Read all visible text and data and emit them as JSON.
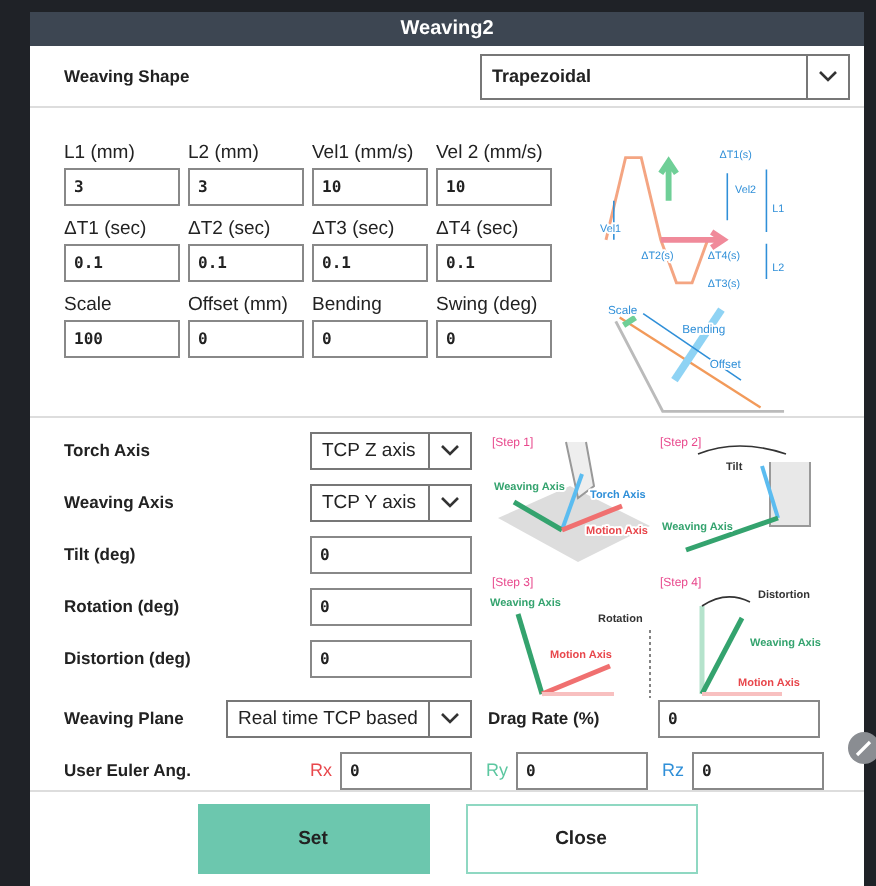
{
  "window": {
    "title": "Weaving2"
  },
  "weaving_shape": {
    "label": "Weaving Shape",
    "value": "Trapezoidal"
  },
  "parameters": [
    {
      "label": "L1 (mm)",
      "value": "3"
    },
    {
      "label": "L2 (mm)",
      "value": "3"
    },
    {
      "label": "Vel1 (mm/s)",
      "value": "10"
    },
    {
      "label": "Vel 2 (mm/s)",
      "value": "10"
    },
    {
      "label": "ΔT1 (sec)",
      "value": "0.1"
    },
    {
      "label": "ΔT2 (sec)",
      "value": "0.1"
    },
    {
      "label": "ΔT3 (sec)",
      "value": "0.1"
    },
    {
      "label": "ΔT4 (sec)",
      "value": "0.1"
    },
    {
      "label": "Scale",
      "value": "100"
    },
    {
      "label": "Offset (mm)",
      "value": "0"
    },
    {
      "label": "Bending",
      "value": "0"
    },
    {
      "label": "Swing (deg)",
      "value": "0"
    }
  ],
  "shape_diagram": {
    "labels": [
      "ΔT1(s)",
      "Vel2",
      "L1",
      "Vel1",
      "ΔT2(s)",
      "ΔT4(s)",
      "L2",
      "ΔT3(s)"
    ]
  },
  "offset_diagram": {
    "labels": [
      "Scale",
      "Bending",
      "Offset"
    ]
  },
  "axis_fields": [
    {
      "label": "Torch Axis",
      "kind": "select",
      "value": "TCP Z axis"
    },
    {
      "label": "Weaving Axis",
      "kind": "select",
      "value": "TCP Y axis"
    },
    {
      "label": "Tilt (deg)",
      "kind": "input",
      "value": "0"
    },
    {
      "label": "Rotation (deg)",
      "kind": "input",
      "value": "0"
    },
    {
      "label": "Distortion (deg)",
      "kind": "input",
      "value": "0"
    }
  ],
  "steps": [
    {
      "title": "[Step 1]",
      "labels": [
        "Torch Axis",
        "Weaving Axis",
        "Motion Axis"
      ]
    },
    {
      "title": "[Step 2]",
      "labels": [
        "Tilt",
        "Weaving Axis"
      ]
    },
    {
      "title": "[Step 3]",
      "labels": [
        "Weaving Axis",
        "Motion Axis",
        "Rotation"
      ]
    },
    {
      "title": "[Step 4]",
      "labels": [
        "Distortion",
        "Weaving Axis",
        "Motion Axis"
      ]
    }
  ],
  "weaving_plane": {
    "label": "Weaving Plane",
    "value": "Real time TCP based"
  },
  "drag_rate": {
    "label": "Drag Rate (%)",
    "value": "0"
  },
  "user_euler": {
    "label": "User Euler Ang.",
    "axes": [
      {
        "name": "Rx",
        "color": "#e8474c",
        "value": "0"
      },
      {
        "name": "Ry",
        "color": "#5cc7a0",
        "value": "0"
      },
      {
        "name": "Rz",
        "color": "#2f8fd8",
        "value": "0"
      }
    ]
  },
  "buttons": [
    {
      "label": "Set",
      "kind": "primary"
    },
    {
      "label": "Close",
      "kind": "secondary"
    }
  ]
}
